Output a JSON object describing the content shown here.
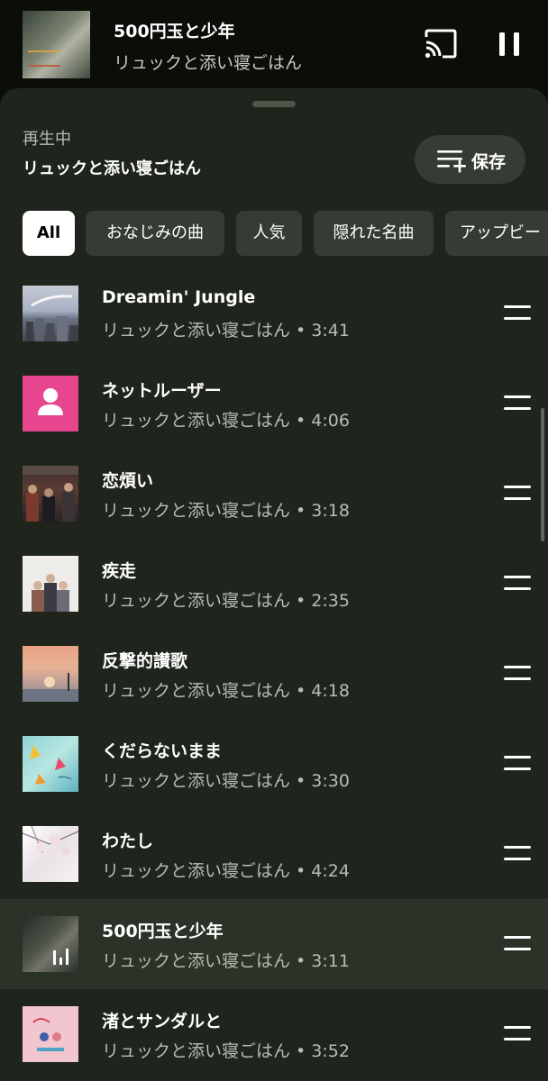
{
  "mini_player": {
    "title": "500円玉と少年",
    "artist": "リュックと添い寝ごはん",
    "cast_icon": "cast-icon",
    "pause_icon": "pause-icon"
  },
  "queue": {
    "now_playing_label": "再生中",
    "source": "リュックと添い寝ごはん",
    "save_label": "保存"
  },
  "chips": [
    {
      "label": "All",
      "active": true
    },
    {
      "label": "おなじみの曲",
      "active": false
    },
    {
      "label": "人気",
      "active": false
    },
    {
      "label": "隠れた名曲",
      "active": false
    },
    {
      "label": "アップビー",
      "active": false
    }
  ],
  "tracks": [
    {
      "title": "Dreamin' Jungle",
      "subtitle": "リュックと添い寝ごはん • 3:41"
    },
    {
      "title": "ネットルーザー",
      "subtitle": "リュックと添い寝ごはん • 4:06"
    },
    {
      "title": "恋煩い",
      "subtitle": "リュックと添い寝ごはん • 3:18"
    },
    {
      "title": "疾走",
      "subtitle": "リュックと添い寝ごはん • 2:35"
    },
    {
      "title": "反撃的讃歌",
      "subtitle": "リュックと添い寝ごはん • 4:18"
    },
    {
      "title": "くだらないまま",
      "subtitle": "リュックと添い寝ごはん • 3:30"
    },
    {
      "title": "わたし",
      "subtitle": "リュックと添い寝ごはん • 4:24"
    },
    {
      "title": "500円玉と少年",
      "subtitle": "リュックと添い寝ごはん • 3:11",
      "now_playing": true
    },
    {
      "title": "渚とサンダルと",
      "subtitle": "リュックと添い寝ごはん • 3:52"
    }
  ]
}
